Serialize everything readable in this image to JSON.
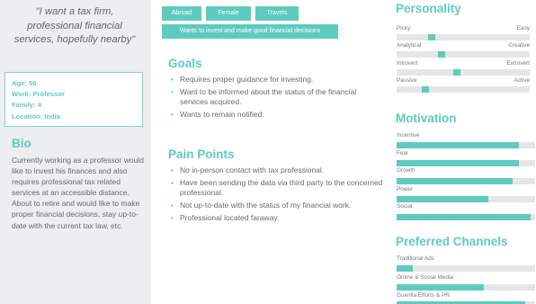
{
  "quote": "\"I want a tax firm, professional financial services, hopefully nearby\"",
  "profile": {
    "age": "Age: 56",
    "work": "Work: Professor",
    "family": "Family: 4",
    "location": "Location: India"
  },
  "bio": {
    "title": "Bio",
    "text": "Currently working as a professor would like to invest his finances and also requires professional tax related services at an accessible distance. About to retire and would like to make proper financial decisions, stay up-to-date with the current tax law, etc."
  },
  "tags": [
    "Abroad",
    "Female",
    "Travels",
    "Wants to invest and make good financial decisions"
  ],
  "goals": {
    "title": "Goals",
    "items": [
      "Requires proper guidance for investing.",
      "Want to be informed about the status of the financial services acquired.",
      "Wants to remain notified."
    ]
  },
  "pain_points": {
    "title": "Pain Points",
    "items": [
      "No in-person contact with tax professional.",
      "Have been sending the data via third party to the concerned professional.",
      "Not up-to-date with the status of my financial work.",
      "Professional located faraway."
    ]
  },
  "personality": {
    "title": "Personality",
    "scales": [
      {
        "left": "Picky",
        "right": "Easy",
        "value": 0.25
      },
      {
        "left": "Analytical",
        "right": "Creative",
        "value": 0.33
      },
      {
        "left": "Introvert",
        "right": "Extrovert",
        "value": 0.45
      },
      {
        "left": "Passive",
        "right": "Active",
        "value": 0.2
      }
    ]
  },
  "motivation": {
    "title": "Motivation",
    "items": [
      {
        "label": "Incentive",
        "value": 0.88
      },
      {
        "label": "Fear",
        "value": 0.88
      },
      {
        "label": "Growth",
        "value": 0.84
      },
      {
        "label": "Power",
        "value": 0.66
      },
      {
        "label": "Social",
        "value": 0.97
      }
    ]
  },
  "channels": {
    "title": "Preferred Channels",
    "items": [
      {
        "label": "Traditional Ads",
        "value": 0.12
      },
      {
        "label": "Online & Social Media",
        "value": 0.63
      },
      {
        "label": "Guerilla Efforts & PR",
        "value": 0.93
      }
    ]
  },
  "colors": {
    "accent": "#5ecbbf",
    "panel": "#eceeef",
    "track": "#e5e6e6"
  }
}
